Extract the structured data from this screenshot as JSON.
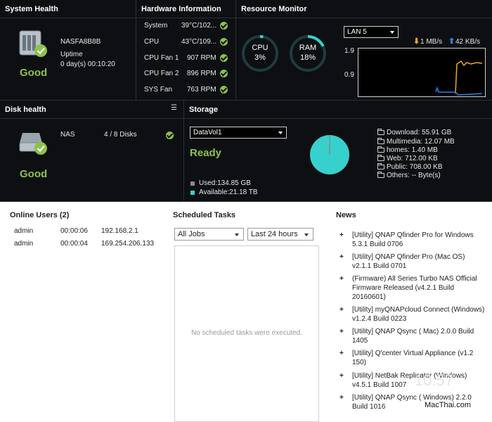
{
  "system_health": {
    "title": "System Health",
    "device_name": "NASFA8B8B",
    "uptime_label": "Uptime",
    "uptime_value": "0 day(s) 00:10:20",
    "status": "Good"
  },
  "hardware": {
    "title": "Hardware Information",
    "rows": [
      {
        "label": "System",
        "value": "39°C/102..."
      },
      {
        "label": "CPU",
        "value": "43°C/109..."
      },
      {
        "label": "CPU Fan 1",
        "value": "907 RPM"
      },
      {
        "label": "CPU Fan 2",
        "value": "896 RPM"
      },
      {
        "label": "SYS Fan",
        "value": "763 RPM"
      }
    ]
  },
  "resource_monitor": {
    "title": "Resource Monitor",
    "cpu": {
      "label": "CPU",
      "value": "3%",
      "percent": 3
    },
    "ram": {
      "label": "RAM",
      "value": "18%",
      "percent": 18
    },
    "network_select": "LAN 5",
    "upload": "1 MB/s",
    "download": "42 KB/s",
    "axis_top": "1.9",
    "axis_mid": "0.9"
  },
  "disk_health": {
    "title": "Disk health",
    "name": "NAS",
    "disks": "4 / 8 Disks",
    "status": "Good"
  },
  "storage": {
    "title": "Storage",
    "volume_select": "DataVol1",
    "status": "Ready",
    "used": "Used:134.85 GB",
    "available": "Available:21.18 TB",
    "folders": [
      "Download: 55.91 GB",
      "Multimedia: 12.07 MB",
      "homes: 1.40 MB",
      "Web: 712.00 KB",
      "Public: 708.00 KB",
      "Others: -- Byte(s)"
    ],
    "colors": {
      "used": "#8a8a8a",
      "available": "#36d1cc"
    }
  },
  "online_users": {
    "title": "Online Users (2)",
    "rows": [
      {
        "user": "admin",
        "time": "00:00:06",
        "ip": "192.168.2.1"
      },
      {
        "user": "admin",
        "time": "00:00:04",
        "ip": "169.254.206.133"
      }
    ]
  },
  "scheduled_tasks": {
    "title": "Scheduled Tasks",
    "filter_jobs": "All Jobs",
    "filter_time": "Last 24 hours",
    "empty_message": "No scheduled tasks were executed."
  },
  "news": {
    "title": "News",
    "items": [
      "[Utility] QNAP Qfinder Pro for Windows 5.3.1 Build 0706",
      "[Utility] QNAP Qfinder Pro (Mac OS) v2.1.1 Build 0701",
      "(Firmware) All Series Turbo NAS Official Firmware Released (v4.2.1 Build 20160601)",
      "[Utility] myQNAPcloud Connect (Windows) v1.2.4 Build 0223",
      "[Utility] QNAP Qsync ( Mac) 2.0.0 Build 1405",
      "[Utility] Q'center Virtual Appliance (v1.2 150)",
      "[Utility] NetBak Replicator (Windows) v4.5.1 Build 1007",
      "[Utility] QNAP Qsync ( Windows) 2.2.0 Build 1016"
    ]
  },
  "watermark": {
    "clock": "10:57",
    "brand": "MacThai.com"
  },
  "colors": {
    "accent_green": "#8bc34a",
    "accent_cyan": "#36d1cc",
    "upload_orange": "#f5a623",
    "download_blue": "#2f7ff0"
  }
}
